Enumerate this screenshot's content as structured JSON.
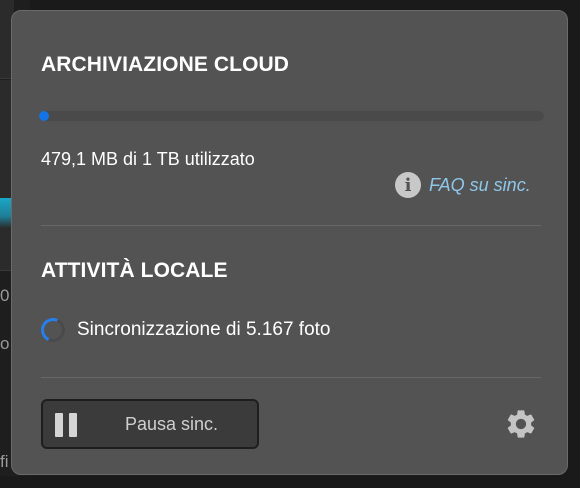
{
  "background": {
    "fragment_texts": [
      "0",
      "o",
      "fi"
    ]
  },
  "cloud_storage": {
    "title": "ARCHIVIAZIONE CLOUD",
    "usage_text": "479,1 MB di 1 TB utilizzato",
    "usage_fraction": 0.0005,
    "faq_label": "FAQ su sinc.",
    "info_icon": "info-circle-icon"
  },
  "local_activity": {
    "title": "ATTIVITÀ LOCALE",
    "sync_status": "Sincronizzazione di 5.167 foto",
    "spinner_icon": "loading-spinner-icon"
  },
  "footer": {
    "pause_label": "Pausa sinc.",
    "pause_icon": "pause-icon",
    "settings_icon": "gear-icon"
  },
  "colors": {
    "panel": "#535353",
    "accent": "#1473e6",
    "link": "#8fc7ea"
  }
}
